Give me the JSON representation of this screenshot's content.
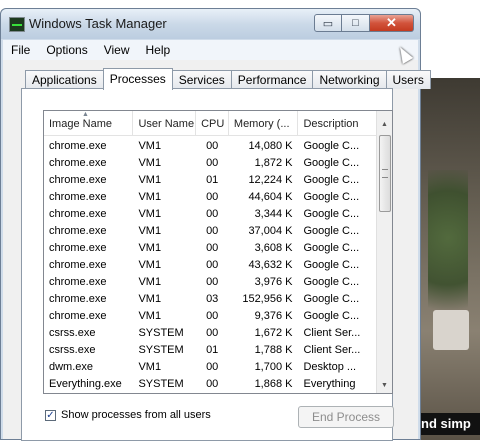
{
  "window": {
    "title": "Windows Task Manager",
    "controls": {
      "minimize": "▭",
      "maximize": "□",
      "close": "✕"
    }
  },
  "menu": [
    "File",
    "Options",
    "View",
    "Help"
  ],
  "tabs": [
    "Applications",
    "Processes",
    "Services",
    "Performance",
    "Networking",
    "Users"
  ],
  "active_tab": "Processes",
  "table": {
    "headers": [
      "Image Name",
      "User Name",
      "CPU",
      "Memory (...",
      "Description"
    ],
    "rows": [
      [
        "chrome.exe",
        "VM1",
        "00",
        "14,080 K",
        "Google C..."
      ],
      [
        "chrome.exe",
        "VM1",
        "00",
        "1,872 K",
        "Google C..."
      ],
      [
        "chrome.exe",
        "VM1",
        "01",
        "12,224 K",
        "Google C..."
      ],
      [
        "chrome.exe",
        "VM1",
        "00",
        "44,604 K",
        "Google C..."
      ],
      [
        "chrome.exe",
        "VM1",
        "00",
        "3,344 K",
        "Google C..."
      ],
      [
        "chrome.exe",
        "VM1",
        "00",
        "37,004 K",
        "Google C..."
      ],
      [
        "chrome.exe",
        "VM1",
        "00",
        "3,608 K",
        "Google C..."
      ],
      [
        "chrome.exe",
        "VM1",
        "00",
        "43,632 K",
        "Google C..."
      ],
      [
        "chrome.exe",
        "VM1",
        "00",
        "3,976 K",
        "Google C..."
      ],
      [
        "chrome.exe",
        "VM1",
        "03",
        "152,956 K",
        "Google C..."
      ],
      [
        "chrome.exe",
        "VM1",
        "00",
        "9,376 K",
        "Google C..."
      ],
      [
        "csrss.exe",
        "SYSTEM",
        "00",
        "1,672 K",
        "Client Ser..."
      ],
      [
        "csrss.exe",
        "SYSTEM",
        "01",
        "1,788 K",
        "Client Ser..."
      ],
      [
        "dwm.exe",
        "VM1",
        "00",
        "1,700 K",
        "Desktop ..."
      ],
      [
        "Everything.exe",
        "SYSTEM",
        "00",
        "1,868 K",
        "Everything"
      ]
    ]
  },
  "show_all_processes": {
    "label": "Show processes from all users",
    "checked": true
  },
  "end_process_label": "End Process",
  "background_caption": "nd simp"
}
